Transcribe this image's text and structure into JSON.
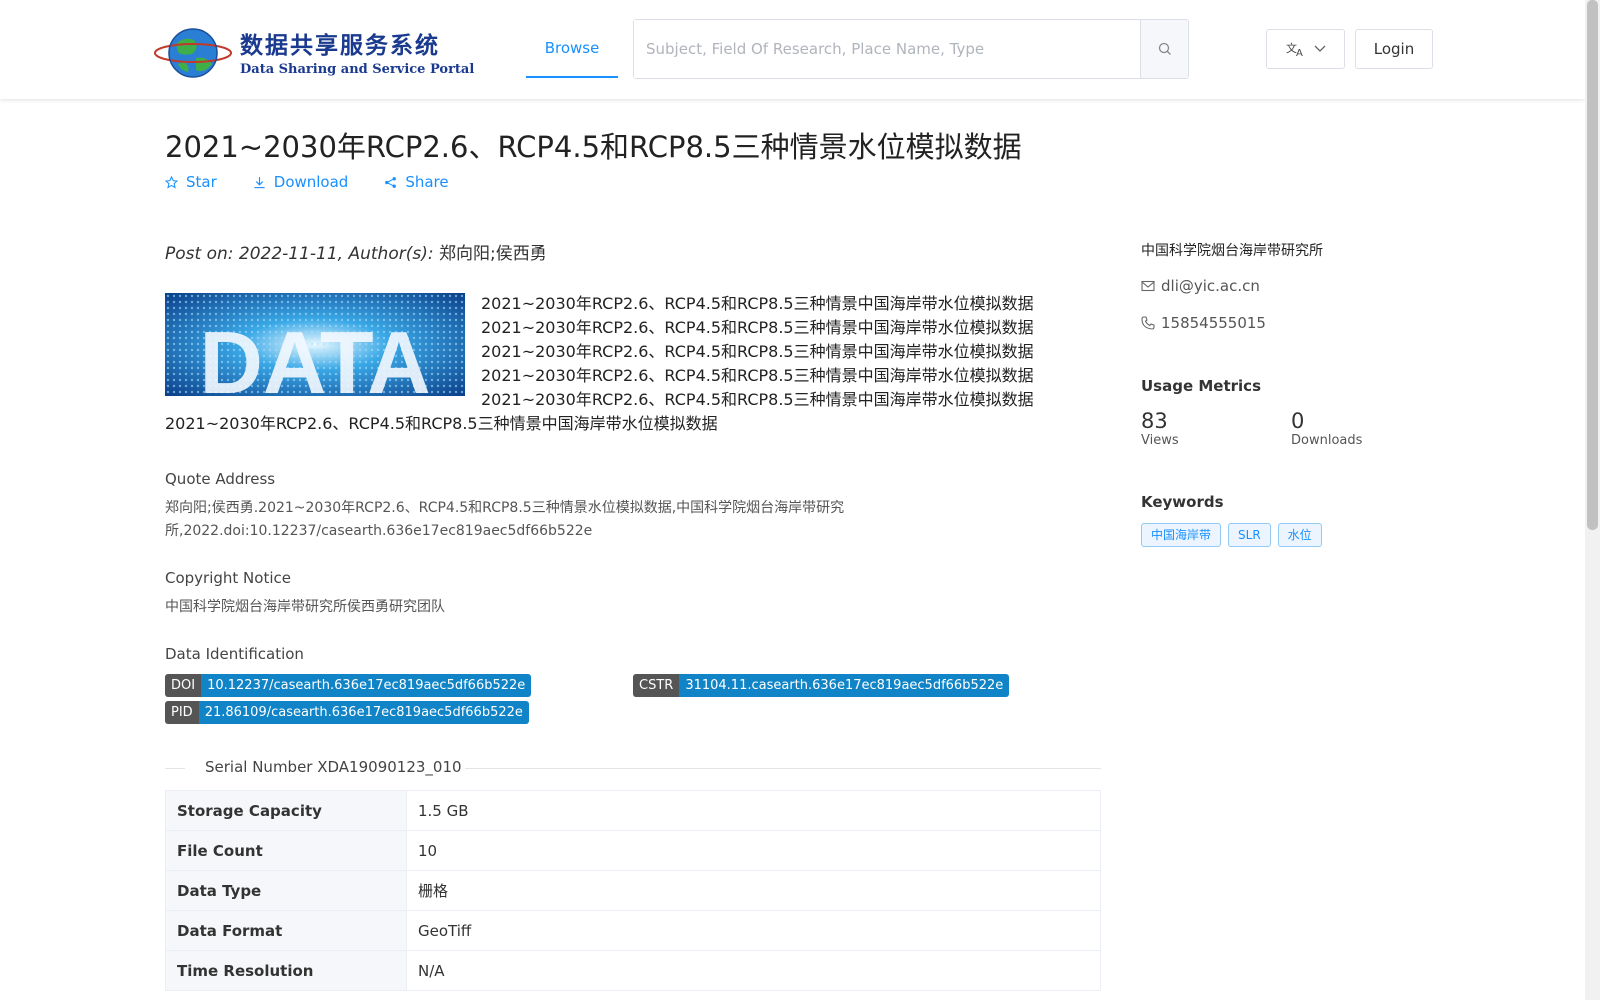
{
  "header": {
    "logo_cn": "数据共享服务系统",
    "logo_en": "Data Sharing and Service Portal",
    "nav_browse": "Browse",
    "search_placeholder": "Subject, Field Of Research, Place Name, Type",
    "login_label": "Login"
  },
  "dataset": {
    "title": "2021~2030年RCP2.6、RCP4.5和RCP8.5三种情景水位模拟数据",
    "actions": {
      "star": "Star",
      "download": "Download",
      "share": "Share"
    },
    "post_prefix": "Post on: 2022-11-11, Author(s): ",
    "authors": "郑向阳;侯西勇",
    "description": "2021~2030年RCP2.6、RCP4.5和RCP8.5三种情景中国海岸带水位模拟数据2021~2030年RCP2.6、RCP4.5和RCP8.5三种情景中国海岸带水位模拟数据2021~2030年RCP2.6、RCP4.5和RCP8.5三种情景中国海岸带水位模拟数据2021~2030年RCP2.6、RCP4.5和RCP8.5三种情景中国海岸带水位模拟数据2021~2030年RCP2.6、RCP4.5和RCP8.5三种情景中国海岸带水位模拟数据2021~2030年RCP2.6、RCP4.5和RCP8.5三种情景中国海岸带水位模拟数据",
    "thumb_text": "DATA",
    "quote_label": "Quote Address",
    "quote_text": "郑向阳;侯西勇.2021~2030年RCP2.6、RCP4.5和RCP8.5三种情景水位模拟数据,中国科学院烟台海岸带研究所,2022.doi:10.12237/casearth.636e17ec819aec5df66b522e",
    "copyright_label": "Copyright Notice",
    "copyright_text": "中国科学院烟台海岸带研究所侯西勇研究团队",
    "identification_label": "Data Identification",
    "doi_key": "DOI",
    "doi_val": "10.12237/casearth.636e17ec819aec5df66b522e",
    "cstr_key": "CSTR",
    "cstr_val": "31104.11.casearth.636e17ec819aec5df66b522e",
    "pid_key": "PID",
    "pid_val": "21.86109/casearth.636e17ec819aec5df66b522e",
    "serial": "Serial Number XDA19090123_010",
    "specs": [
      {
        "key": "Storage Capacity",
        "value": "1.5 GB"
      },
      {
        "key": "File Count",
        "value": "10"
      },
      {
        "key": "Data Type",
        "value": "栅格"
      },
      {
        "key": "Data Format",
        "value": "GeoTiff"
      },
      {
        "key": "Time Resolution",
        "value": "N/A"
      }
    ]
  },
  "sidebar": {
    "org": "中国科学院烟台海岸带研究所",
    "email": "dli@yic.ac.cn",
    "phone": "15854555015",
    "metrics_title": "Usage Metrics",
    "views": "83",
    "views_label": "Views",
    "downloads": "0",
    "downloads_label": "Downloads",
    "keywords_title": "Keywords",
    "keywords": [
      "中国海岸带",
      "SLR",
      "水位"
    ]
  },
  "colors": {
    "accent": "#1890ff",
    "tag_value": "#1084c6",
    "tag_key": "#555555"
  }
}
